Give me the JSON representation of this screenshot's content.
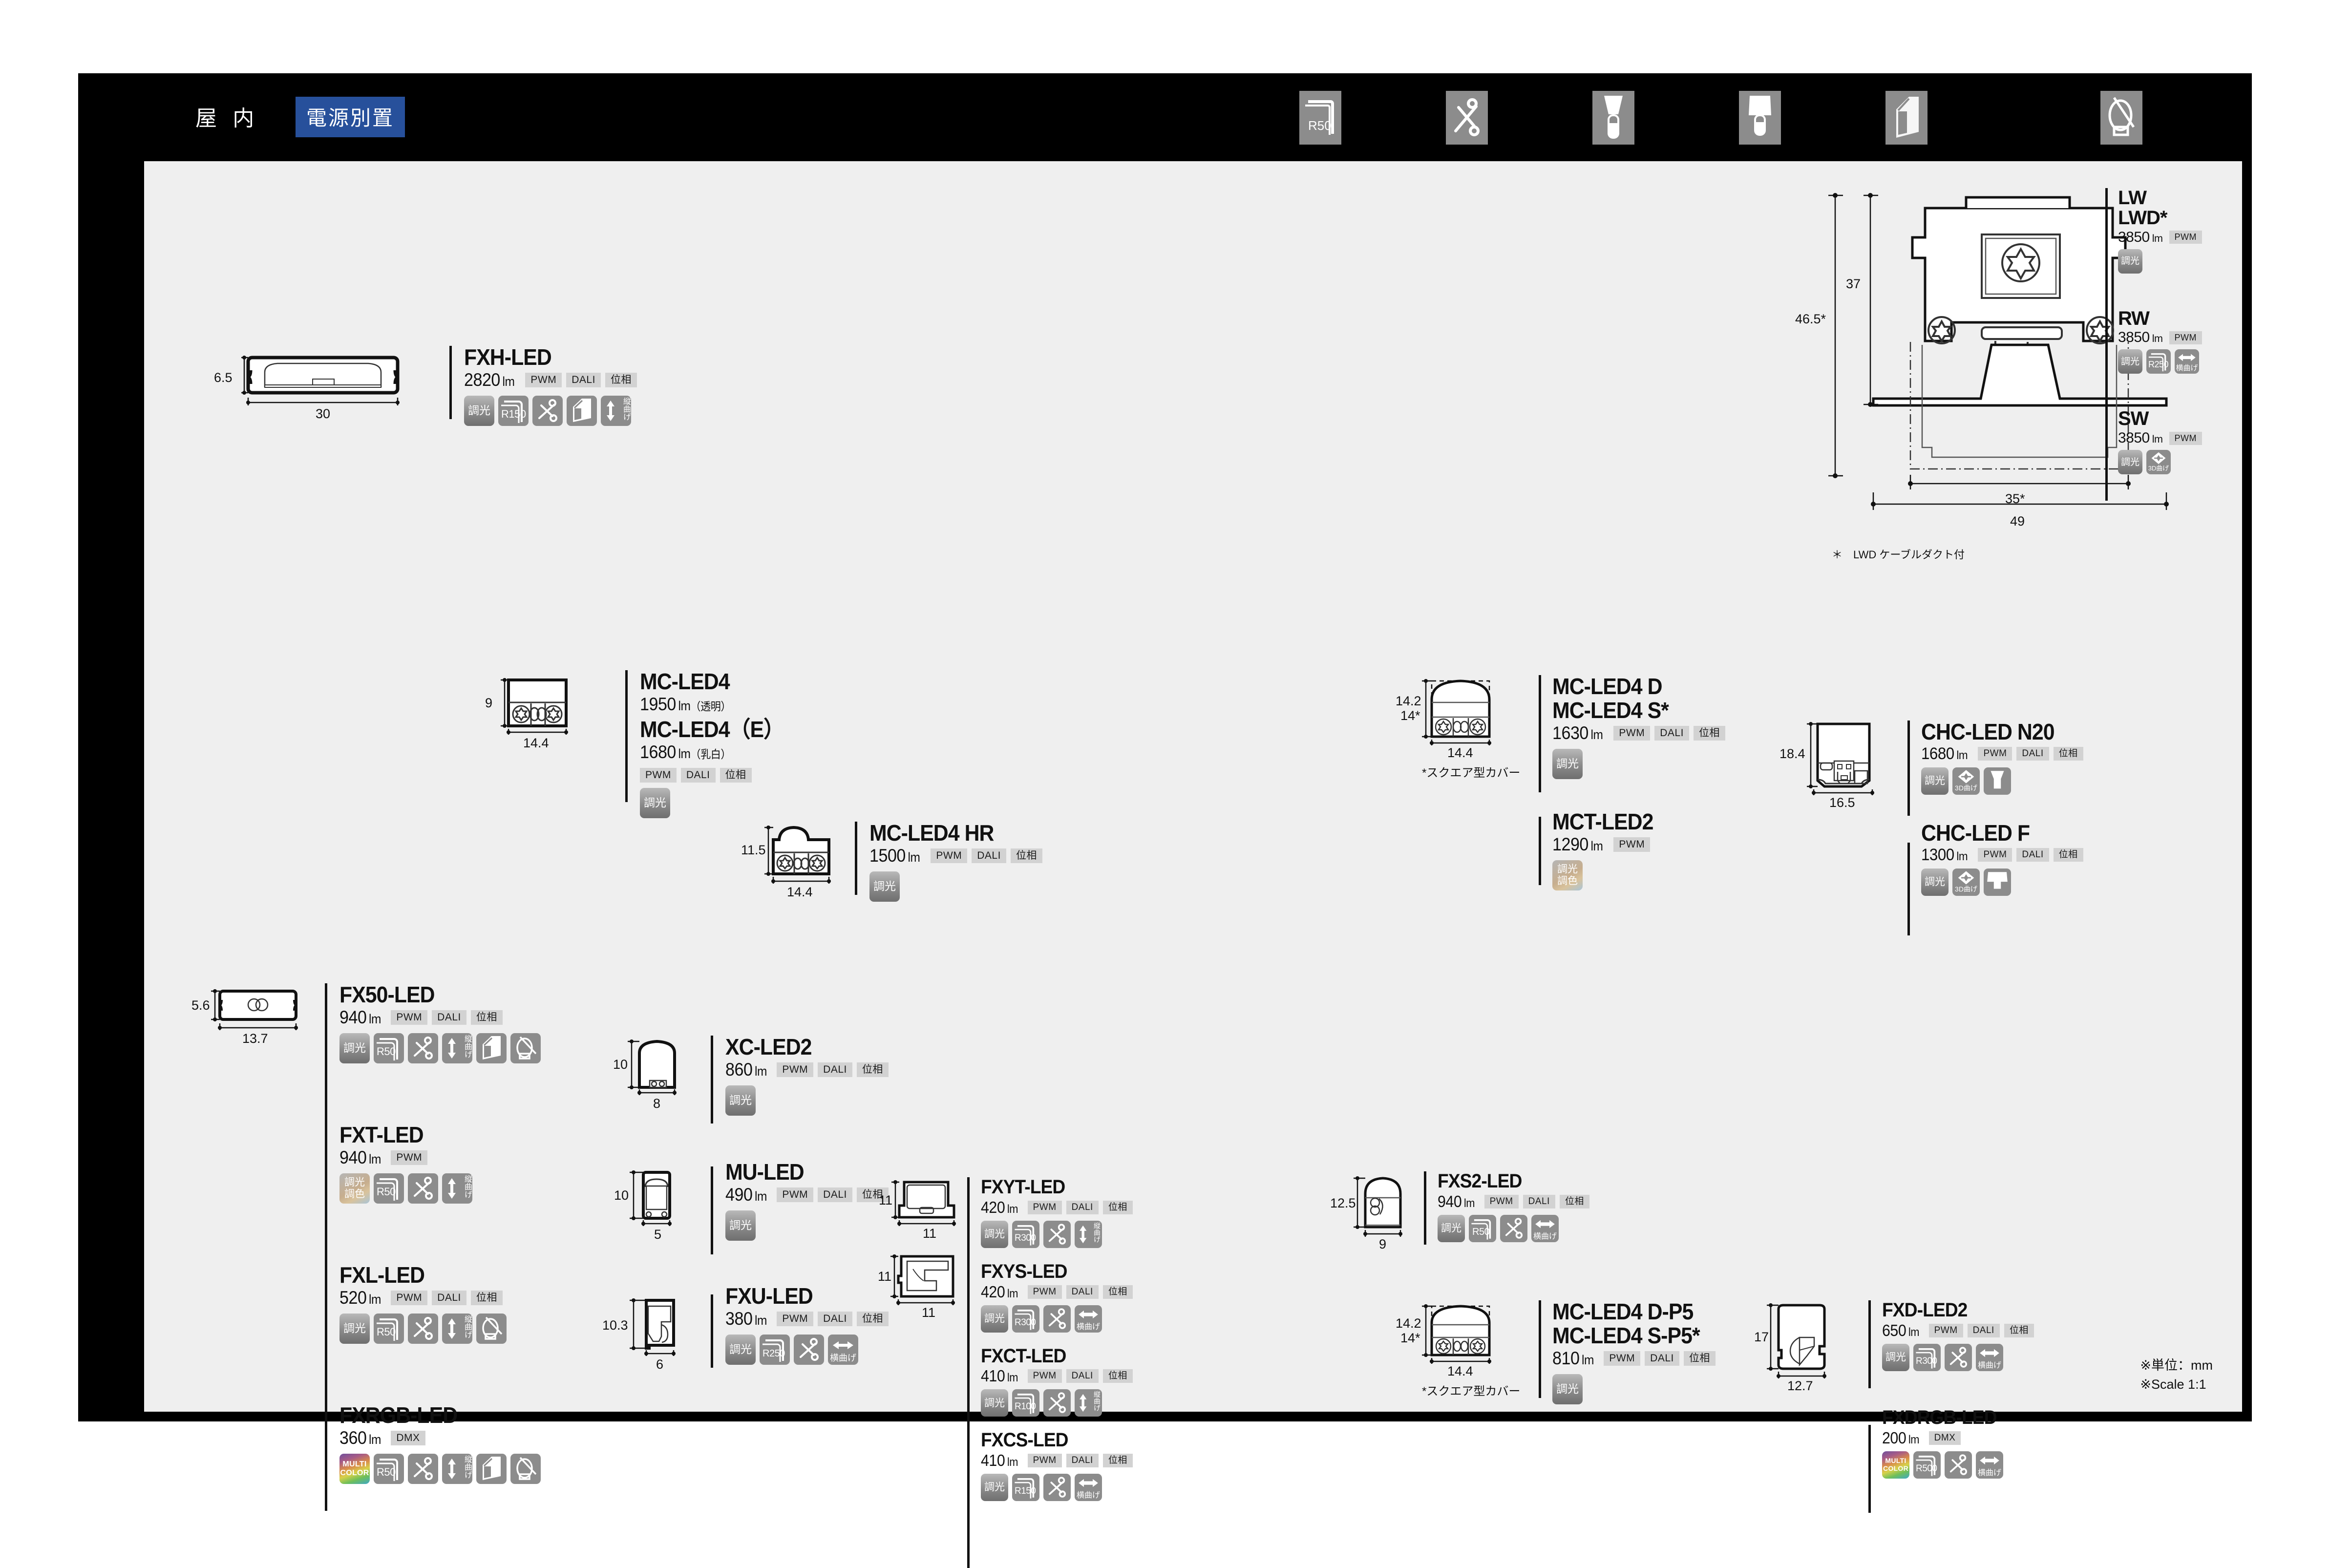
{
  "header": {
    "category_label": "屋 内",
    "badge_label": "電源別置",
    "icons": [
      "r50-corner-icon",
      "scissors-icon",
      "wide-beam-icon",
      "narrow-beam-icon",
      "cut-edge-icon",
      "loop-bend-icon"
    ]
  },
  "footer": {
    "unit_note": "※単位：mm",
    "scale_note": "※Scale  1:1"
  },
  "drawing_notes": {
    "lwd_note": "＊　LWD ケーブルダクト付",
    "square_cover_note": "*スクエア型カバー"
  },
  "products": [
    {
      "id": "fxh-led",
      "name": "FXH-LED",
      "lumen": "2820",
      "unit": "lm",
      "tags": [
        "PWM",
        "DALI",
        "位相"
      ],
      "icons": [
        "調光",
        "R150",
        "scissors",
        "cut-edge",
        "縦曲げ"
      ],
      "dim_h": "6.5",
      "dim_w": "30"
    },
    {
      "id": "mc-led4",
      "name": "MC-LED4",
      "lumen": "1950",
      "unit": "lm",
      "suffix": "（透明）",
      "name2": "MC-LED4（E）",
      "lumen2": "1680",
      "suffix2": "（乳白）",
      "tags": [
        "PWM",
        "DALI",
        "位相"
      ],
      "icons": [
        "調光"
      ],
      "dim_h": "9",
      "dim_w": "14.4"
    },
    {
      "id": "mc-led4-hr",
      "name": "MC-LED4 HR",
      "lumen": "1500",
      "unit": "lm",
      "tags": [
        "PWM",
        "DALI",
        "位相"
      ],
      "icons": [
        "調光"
      ],
      "dim_h": "11.5",
      "dim_w": "14.4"
    },
    {
      "id": "fx50-led",
      "name": "FX50-LED",
      "lumen": "940",
      "unit": "lm",
      "tags": [
        "PWM",
        "DALI",
        "位相"
      ],
      "icons": [
        "調光",
        "R50",
        "scissors",
        "縦曲げ",
        "cut-edge",
        "loop-bend"
      ],
      "dim_h": "5.6",
      "dim_w": "13.7"
    },
    {
      "id": "fxt-led",
      "name": "FXT-LED",
      "lumen": "940",
      "unit": "lm",
      "tags": [
        "PWM"
      ],
      "icons": [
        "調光調色",
        "R50",
        "scissors",
        "縦曲げ"
      ]
    },
    {
      "id": "fxl-led",
      "name": "FXL-LED",
      "lumen": "520",
      "unit": "lm",
      "tags": [
        "PWM",
        "DALI",
        "位相"
      ],
      "icons": [
        "調光",
        "R50",
        "scissors",
        "縦曲げ",
        "loop-bend"
      ]
    },
    {
      "id": "fxrgb-led",
      "name": "FXRGB-LED",
      "lumen": "360",
      "unit": "lm",
      "tags": [
        "DMX"
      ],
      "icons": [
        "MULTI COLOR",
        "R50",
        "scissors",
        "縦曲げ",
        "cut-edge",
        "loop-bend"
      ]
    },
    {
      "id": "xc-led2",
      "name": "XC-LED2",
      "lumen": "860",
      "unit": "lm",
      "tags": [
        "PWM",
        "DALI",
        "位相"
      ],
      "icons": [
        "調光"
      ],
      "dim_h": "10",
      "dim_w": "8"
    },
    {
      "id": "mu-led",
      "name": "MU-LED",
      "lumen": "490",
      "unit": "lm",
      "tags": [
        "PWM",
        "DALI",
        "位相"
      ],
      "icons": [
        "調光"
      ],
      "dim_h": "10",
      "dim_w": "5"
    },
    {
      "id": "fxu-led",
      "name": "FXU-LED",
      "lumen": "380",
      "unit": "lm",
      "tags": [
        "PWM",
        "DALI",
        "位相"
      ],
      "icons": [
        "調光",
        "R250",
        "scissors",
        "横曲げ"
      ],
      "dim_h": "10.3",
      "dim_w": "6"
    },
    {
      "id": "fxyt-led",
      "name": "FXYT-LED",
      "lumen": "420",
      "unit": "lm",
      "tags": [
        "PWM",
        "DALI",
        "位相"
      ],
      "icons": [
        "調光",
        "R300",
        "scissors",
        "縦曲げ"
      ],
      "dim_h": "11",
      "dim_w": "11"
    },
    {
      "id": "fxys-led",
      "name": "FXYS-LED",
      "lumen": "420",
      "unit": "lm",
      "tags": [
        "PWM",
        "DALI",
        "位相"
      ],
      "icons": [
        "調光",
        "R300",
        "scissors",
        "横曲げ"
      ],
      "dim_h": "11",
      "dim_w": "11"
    },
    {
      "id": "fxct-led",
      "name": "FXCT-LED",
      "lumen": "410",
      "unit": "lm",
      "tags": [
        "PWM",
        "DALI",
        "位相"
      ],
      "icons": [
        "調光",
        "R100",
        "scissors",
        "縦曲げ"
      ]
    },
    {
      "id": "fxcs-led",
      "name": "FXCS-LED",
      "lumen": "410",
      "unit": "lm",
      "tags": [
        "PWM",
        "DALI",
        "位相"
      ],
      "icons": [
        "調光",
        "R150",
        "scissors",
        "横曲げ"
      ]
    },
    {
      "id": "mc-led4-ds",
      "name": "MC-LED4 D",
      "name2": "MC-LED4 S*",
      "lumen": "1630",
      "unit": "lm",
      "tags": [
        "PWM",
        "DALI",
        "位相"
      ],
      "icons": [
        "調光"
      ],
      "dim_h": "14.2",
      "dim_h2": "14*",
      "dim_w": "14.4"
    },
    {
      "id": "mct-led2",
      "name": "MCT-LED2",
      "lumen": "1290",
      "unit": "lm",
      "tags": [
        "PWM"
      ],
      "icons": [
        "調光調色"
      ]
    },
    {
      "id": "fxs2-led",
      "name": "FXS2-LED",
      "lumen": "940",
      "unit": "lm",
      "tags": [
        "PWM",
        "DALI",
        "位相"
      ],
      "icons": [
        "調光",
        "R50",
        "scissors",
        "横曲げ"
      ],
      "dim_h": "12.5",
      "dim_w": "9"
    },
    {
      "id": "mc-led4-dp5",
      "name": "MC-LED4 D-P5",
      "name2": "MC-LED4 S-P5*",
      "lumen": "810",
      "unit": "lm",
      "tags": [
        "PWM",
        "DALI",
        "位相"
      ],
      "icons": [
        "調光"
      ],
      "dim_h": "14.2",
      "dim_h2": "14*",
      "dim_w": "14.4"
    },
    {
      "id": "chc-led-n20",
      "name": "CHC-LED N20",
      "lumen": "1680",
      "unit": "lm",
      "tags": [
        "PWM",
        "DALI",
        "位相"
      ],
      "icons": [
        "調光",
        "3D曲げ",
        "wide-beam"
      ],
      "dim_h": "18.4",
      "dim_w": "16.5"
    },
    {
      "id": "chc-led-f",
      "name": "CHC-LED F",
      "lumen": "1300",
      "unit": "lm",
      "tags": [
        "PWM",
        "DALI",
        "位相"
      ],
      "icons": [
        "調光",
        "3D曲げ",
        "narrow-beam"
      ]
    },
    {
      "id": "fxd-led2",
      "name": "FXD-LED2",
      "lumen": "650",
      "unit": "lm",
      "tags": [
        "PWM",
        "DALI",
        "位相"
      ],
      "icons": [
        "調光",
        "R300",
        "scissors",
        "横曲げ"
      ],
      "dim_h": "17",
      "dim_w": "12.7"
    },
    {
      "id": "fxdrgb-led",
      "name": "FXDRGB-LED",
      "lumen": "200",
      "unit": "lm",
      "tags": [
        "DMX"
      ],
      "icons": [
        "MULTI COLOR",
        "R500",
        "scissors",
        "横曲げ"
      ]
    },
    {
      "id": "lw-lwd",
      "name": "LW",
      "name2": "LWD*",
      "lumen": "3850",
      "unit": "lm",
      "tags": [
        "PWM"
      ],
      "icons": [
        "調光"
      ],
      "dim_h": "37",
      "dim_h2": "46.5*",
      "dim_w": "35*",
      "dim_w2": "49"
    },
    {
      "id": "rw",
      "name": "RW",
      "lumen": "3850",
      "unit": "lm",
      "tags": [
        "PWM"
      ],
      "icons": [
        "調光",
        "R250",
        "横曲げ"
      ]
    },
    {
      "id": "sw",
      "name": "SW",
      "lumen": "3850",
      "unit": "lm",
      "tags": [
        "PWM"
      ],
      "icons": [
        "調光",
        "3D曲げ"
      ]
    }
  ]
}
